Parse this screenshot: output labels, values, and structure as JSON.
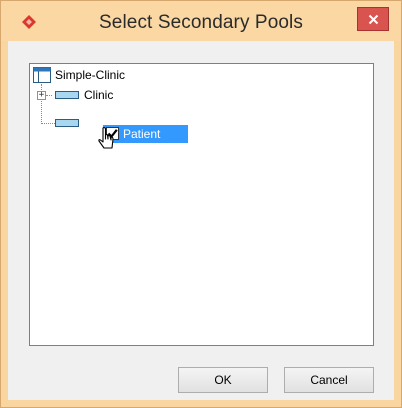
{
  "window": {
    "title": "Select Secondary Pools",
    "close_label": "×",
    "accent_color": "#fad7a3",
    "close_color": "#d9534f"
  },
  "tree": {
    "root": {
      "label": "Simple-Clinic",
      "icon": "diagram-icon"
    },
    "children": [
      {
        "label": "Clinic",
        "icon": "pool-icon",
        "expander": "+",
        "checked": false,
        "selected": false
      },
      {
        "label": "Patient",
        "icon": "pool-icon",
        "checked": true,
        "selected": true
      }
    ],
    "selection_color": "#3399ff"
  },
  "buttons": {
    "ok": "OK",
    "cancel": "Cancel"
  },
  "cursor": {
    "icon": "pointer-cursor-icon"
  }
}
